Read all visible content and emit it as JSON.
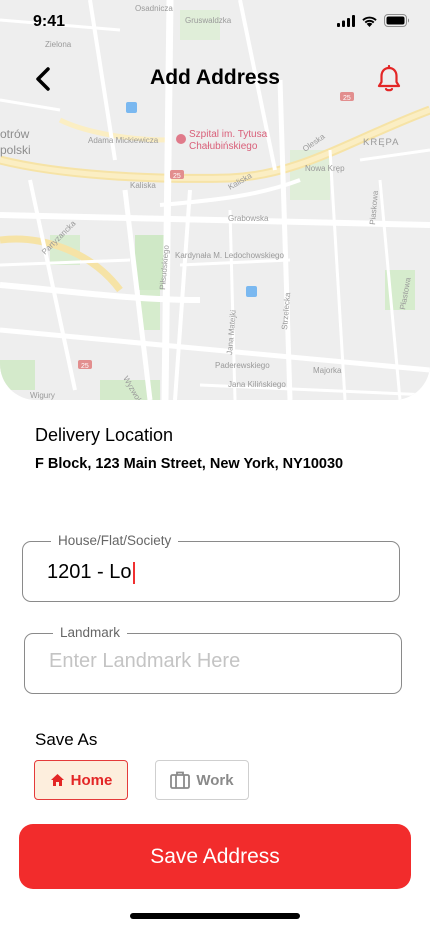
{
  "status_bar": {
    "time": "9:41"
  },
  "header": {
    "title": "Add Address",
    "back_icon": "chevron-left-icon",
    "bell_icon": "bell-icon"
  },
  "map": {
    "labels": {
      "osadnicza": "Osadnicza",
      "gruswaldzka": "Gruswaldzka",
      "zielona": "Zielona",
      "szpital_1": "Szpital im. Tytusa",
      "szpital_2": "Chałubińskiego",
      "adama": "Adama Mickiewicza",
      "krepa": "KRĘPA",
      "piotrkow": "otrów",
      "polski": "polski",
      "oleska": "Oleska",
      "nowa_krepa": "Nowa Kręp",
      "kaliska": "Kaliska",
      "kaliska2": "Kaliska",
      "grabowska": "Grabowska",
      "kardynala": "Kardynała M. Ledochowskiego",
      "pilsudskiego": "Piłsudskiego",
      "strzelecka": "Strzelecka",
      "jana_mateji": "Jana Matejki",
      "paderewskiego": "Paderewskiego",
      "majorka": "Majorka",
      "jana_kilinskiego": "Jana Kilińskiego",
      "wigury": "Wigury",
      "wyzwolenia": "Wyzwolenia",
      "partyzancka": "Partyzancka",
      "piaskowa": "Piaskowa",
      "plastowa": "Płastowa",
      "route_25a": "25",
      "route_25b": "25",
      "route_25c": "25"
    }
  },
  "delivery": {
    "title": "Delivery Location",
    "address": "F Block, 123 Main Street, New York, NY10030"
  },
  "house_field": {
    "label": "House/Flat/Society",
    "value": "1201 - Lo"
  },
  "landmark_field": {
    "label": "Landmark",
    "placeholder": "Enter Landmark Here"
  },
  "save_as": {
    "title": "Save As",
    "options": [
      {
        "label": "Home",
        "icon": "home-icon",
        "selected": true
      },
      {
        "label": "Work",
        "icon": "briefcase-icon",
        "selected": false
      }
    ]
  },
  "save_button": {
    "label": "Save Address"
  },
  "colors": {
    "accent": "#f22c2c",
    "chip_selected_bg": "#fdeedd",
    "text": "#000000"
  }
}
